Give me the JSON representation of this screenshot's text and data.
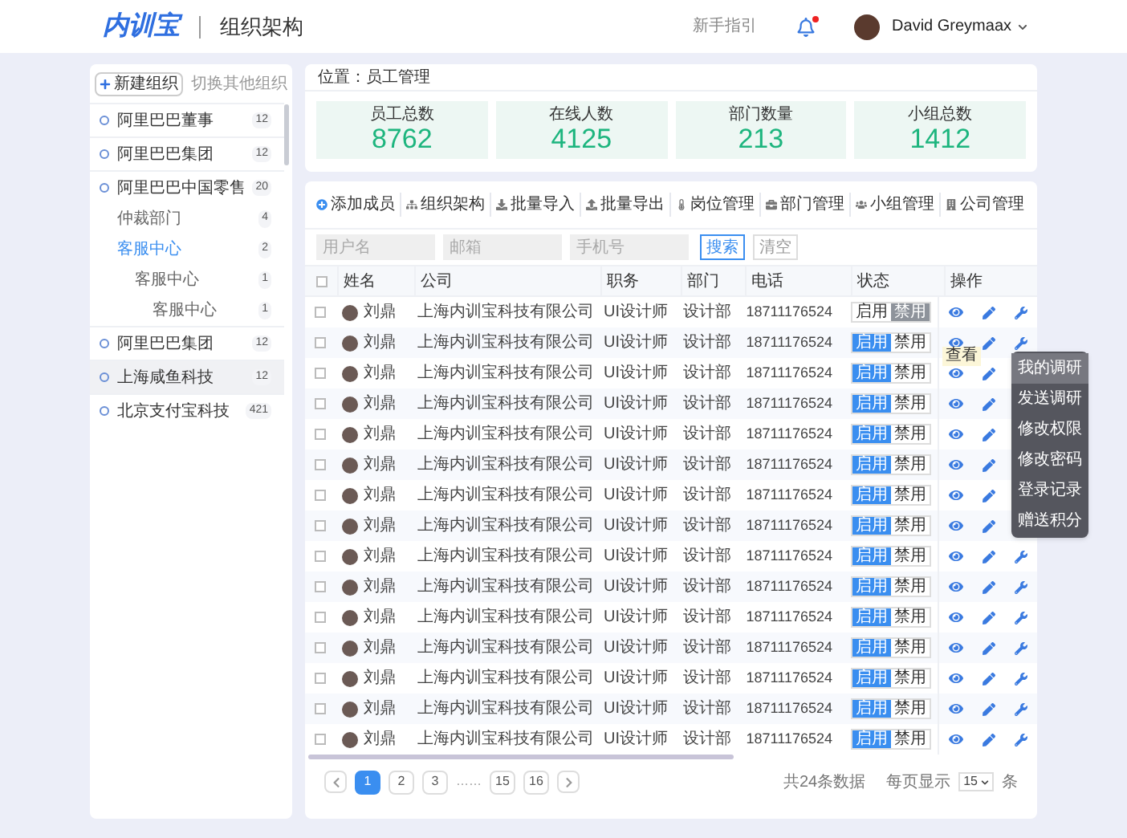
{
  "header": {
    "logo": "内训宝",
    "title": "组织架构",
    "guide": "新手指引",
    "notification": true,
    "user": "David Greymaax"
  },
  "sidebar": {
    "new_button": "新建组织",
    "switch_link": "切换其他组织",
    "items": [
      {
        "label": "阿里巴巴董事",
        "count": "12",
        "selected": false
      },
      {
        "label": "阿里巴巴集团",
        "count": "12",
        "selected": false
      },
      {
        "label": "阿里巴巴中国零售",
        "count": "20",
        "selected": false,
        "children": [
          {
            "label": "仲裁部门",
            "count": "4",
            "selected": false
          },
          {
            "label": "客服中心",
            "count": "2",
            "selected": true,
            "children": [
              {
                "label": "客服中心",
                "count": "1",
                "selected": false,
                "children": [
                  {
                    "label": "客服中心",
                    "count": "1",
                    "selected": false
                  }
                ]
              }
            ]
          }
        ]
      },
      {
        "label": "阿里巴巴集团",
        "count": "12",
        "selected": false
      },
      {
        "label": "上海咸鱼科技",
        "count": "12",
        "selected": true
      },
      {
        "label": "北京支付宝科技",
        "count": "421",
        "selected": false
      }
    ]
  },
  "location": "位置：员工管理",
  "stats": [
    {
      "label": "员工总数",
      "value": "8762"
    },
    {
      "label": "在线人数",
      "value": "4125"
    },
    {
      "label": "部门数量",
      "value": "213"
    },
    {
      "label": "小组总数",
      "value": "1412"
    }
  ],
  "toolbar": [
    "添加成员",
    "组织架构",
    "批量导入",
    "批量导出",
    "岗位管理",
    "部门管理",
    "小组管理",
    "公司管理"
  ],
  "search": {
    "fields": [
      {
        "placeholder": "用户名"
      },
      {
        "placeholder": "邮箱"
      },
      {
        "placeholder": "手机号"
      }
    ],
    "search_button": "搜索",
    "clear_button": "清空"
  },
  "table": {
    "all_checked": false,
    "columns": [
      "姓名",
      "公司",
      "职务",
      "部门",
      "电话",
      "状态",
      "操作"
    ],
    "rows": [
      {
        "checked": false,
        "name": "刘鼎",
        "company": "上海内训宝科技有限公司",
        "role": "UI设计师",
        "dept": "设计部",
        "phone": "18711176524",
        "on_label": "启用",
        "off_label": "禁用",
        "enabled": false
      },
      {
        "checked": false,
        "name": "刘鼎",
        "company": "上海内训宝科技有限公司",
        "role": "UI设计师",
        "dept": "设计部",
        "phone": "18711176524",
        "on_label": "启用",
        "off_label": "禁用",
        "enabled": true,
        "tooltip": "查看",
        "menu": [
          {
            "label": "我的调研",
            "selected": true
          },
          {
            "label": "发送调研",
            "selected": false
          },
          {
            "label": "修改权限",
            "selected": false
          },
          {
            "label": "修改密码",
            "selected": false
          },
          {
            "label": "登录记录",
            "selected": false
          },
          {
            "label": "赠送积分",
            "selected": false
          }
        ]
      },
      {
        "checked": false,
        "name": "刘鼎",
        "company": "上海内训宝科技有限公司",
        "role": "UI设计师",
        "dept": "设计部",
        "phone": "18711176524",
        "on_label": "启用",
        "off_label": "禁用",
        "enabled": true
      },
      {
        "checked": false,
        "name": "刘鼎",
        "company": "上海内训宝科技有限公司",
        "role": "UI设计师",
        "dept": "设计部",
        "phone": "18711176524",
        "on_label": "启用",
        "off_label": "禁用",
        "enabled": true
      },
      {
        "checked": false,
        "name": "刘鼎",
        "company": "上海内训宝科技有限公司",
        "role": "UI设计师",
        "dept": "设计部",
        "phone": "18711176524",
        "on_label": "启用",
        "off_label": "禁用",
        "enabled": true
      },
      {
        "checked": false,
        "name": "刘鼎",
        "company": "上海内训宝科技有限公司",
        "role": "UI设计师",
        "dept": "设计部",
        "phone": "18711176524",
        "on_label": "启用",
        "off_label": "禁用",
        "enabled": true
      },
      {
        "checked": false,
        "name": "刘鼎",
        "company": "上海内训宝科技有限公司",
        "role": "UI设计师",
        "dept": "设计部",
        "phone": "18711176524",
        "on_label": "启用",
        "off_label": "禁用",
        "enabled": true
      },
      {
        "checked": false,
        "name": "刘鼎",
        "company": "上海内训宝科技有限公司",
        "role": "UI设计师",
        "dept": "设计部",
        "phone": "18711176524",
        "on_label": "启用",
        "off_label": "禁用",
        "enabled": true
      },
      {
        "checked": false,
        "name": "刘鼎",
        "company": "上海内训宝科技有限公司",
        "role": "UI设计师",
        "dept": "设计部",
        "phone": "18711176524",
        "on_label": "启用",
        "off_label": "禁用",
        "enabled": true
      },
      {
        "checked": false,
        "name": "刘鼎",
        "company": "上海内训宝科技有限公司",
        "role": "UI设计师",
        "dept": "设计部",
        "phone": "18711176524",
        "on_label": "启用",
        "off_label": "禁用",
        "enabled": true
      },
      {
        "checked": false,
        "name": "刘鼎",
        "company": "上海内训宝科技有限公司",
        "role": "UI设计师",
        "dept": "设计部",
        "phone": "18711176524",
        "on_label": "启用",
        "off_label": "禁用",
        "enabled": true
      },
      {
        "checked": false,
        "name": "刘鼎",
        "company": "上海内训宝科技有限公司",
        "role": "UI设计师",
        "dept": "设计部",
        "phone": "18711176524",
        "on_label": "启用",
        "off_label": "禁用",
        "enabled": true
      },
      {
        "checked": false,
        "name": "刘鼎",
        "company": "上海内训宝科技有限公司",
        "role": "UI设计师",
        "dept": "设计部",
        "phone": "18711176524",
        "on_label": "启用",
        "off_label": "禁用",
        "enabled": true
      },
      {
        "checked": false,
        "name": "刘鼎",
        "company": "上海内训宝科技有限公司",
        "role": "UI设计师",
        "dept": "设计部",
        "phone": "18711176524",
        "on_label": "启用",
        "off_label": "禁用",
        "enabled": true
      },
      {
        "checked": false,
        "name": "刘鼎",
        "company": "上海内训宝科技有限公司",
        "role": "UI设计师",
        "dept": "设计部",
        "phone": "18711176524",
        "on_label": "启用",
        "off_label": "禁用",
        "enabled": true
      }
    ]
  },
  "pagination": {
    "pages": [
      {
        "label": "1",
        "selected": true
      },
      {
        "label": "2",
        "selected": false
      },
      {
        "label": "3",
        "selected": false
      },
      {
        "label": "……",
        "kind": "gap"
      },
      {
        "label": "15",
        "selected": false
      },
      {
        "label": "16",
        "selected": false
      }
    ],
    "total": "共24条数据",
    "per_page_label": "每页显示",
    "per_page_value": "15",
    "per_page_unit": "条"
  }
}
